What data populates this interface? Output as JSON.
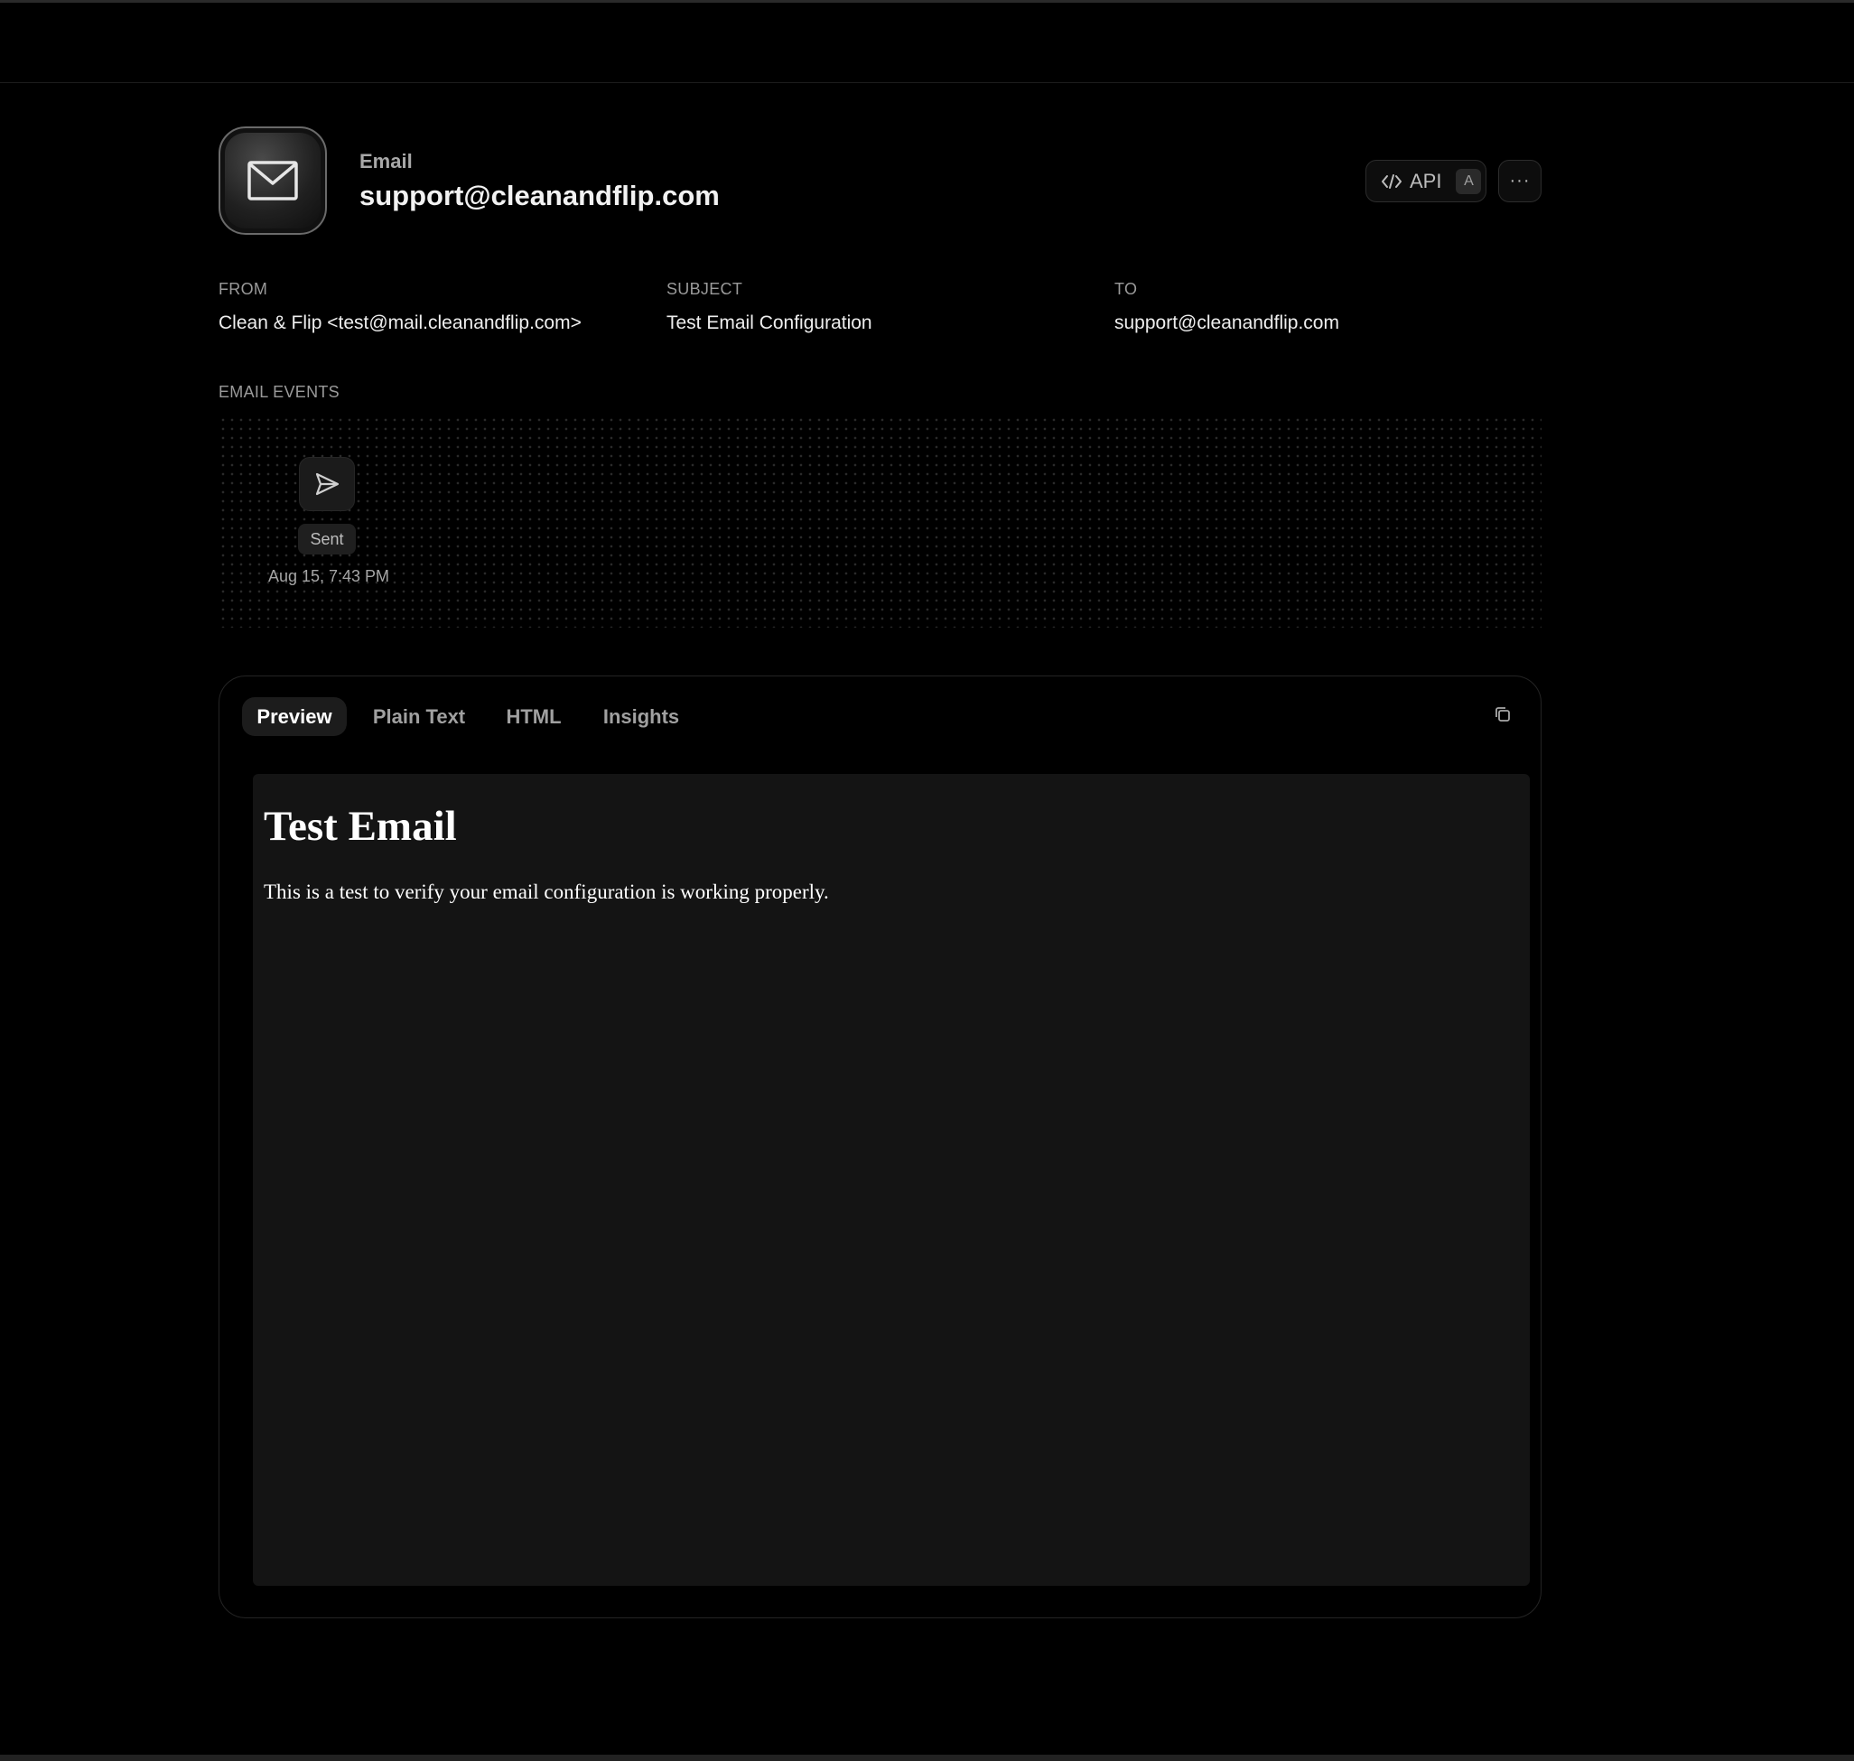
{
  "header": {
    "eyebrow": "Email",
    "title": "support@cleanandflip.com",
    "icon": "envelope-icon",
    "api_label": "API",
    "api_shortcut": "A",
    "more_label": "···"
  },
  "meta": {
    "from_label": "FROM",
    "from_value": "Clean & Flip <test@mail.cleanandflip.com>",
    "subject_label": "SUBJECT",
    "subject_value": "Test Email Configuration",
    "to_label": "TO",
    "to_value": "support@cleanandflip.com"
  },
  "events": {
    "label": "EMAIL EVENTS",
    "items": [
      {
        "status": "Sent",
        "time": "Aug 15, 7:43 PM",
        "icon": "send-icon"
      }
    ]
  },
  "tabs": [
    {
      "label": "Preview",
      "active": true
    },
    {
      "label": "Plain Text",
      "active": false
    },
    {
      "label": "HTML",
      "active": false
    },
    {
      "label": "Insights",
      "active": false
    }
  ],
  "preview": {
    "heading": "Test Email",
    "body": "This is a test to verify your email configuration is working properly."
  },
  "colors": {
    "background": "#000000",
    "surface": "#141414",
    "muted_text": "#9a9a9a",
    "text": "#eeeeee"
  }
}
